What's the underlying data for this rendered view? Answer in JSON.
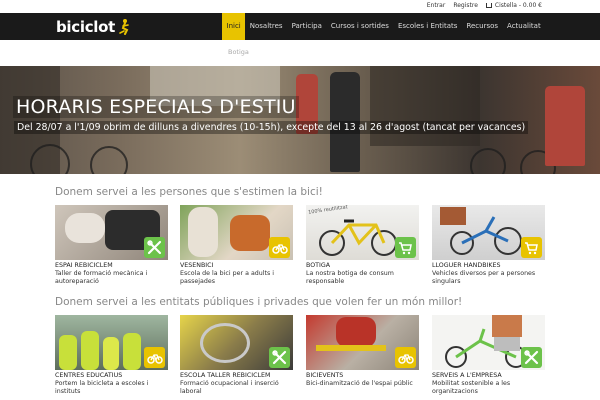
{
  "topbar": {
    "login": "Entrar",
    "register": "Registre",
    "cart": "Cistella - 0.00 €",
    "cart_icon": "cart-icon"
  },
  "logo": {
    "text": "biciclot",
    "icon": "bike-rider-logo-icon"
  },
  "nav": {
    "items": [
      "Inici",
      "Nosaltres",
      "Participa",
      "Cursos i sortides",
      "Escoles i Entitats",
      "Recursos",
      "Actualitat"
    ],
    "active_index": 0,
    "sub_item": "Botiga"
  },
  "hero": {
    "title": "HORARIS ESPECIALS D'ESTIU",
    "subtitle": "Del 28/07 a l'1/09 obrim de dilluns a divendres (10-15h), excepte del 13 al 26 d'agost (tancat per vacances)"
  },
  "section1": {
    "title": "Donem servei a les persones que s'estimen la bici!",
    "cards": [
      {
        "title": "ESPAI REBICICLEM",
        "desc": "Taller de formació mecànica i autoreparació",
        "badge": "green",
        "icon": "wrench-screwdriver-icon"
      },
      {
        "title": "VESenBICI",
        "desc": "Escola de la bici per a adults i passejades",
        "badge": "yellow",
        "icon": "bicycle-icon"
      },
      {
        "title": "BOTIGA",
        "desc": "La nostra botiga de consum responsable",
        "badge": "green",
        "icon": "shopping-cart-icon",
        "stamp": "100% reutilitzat"
      },
      {
        "title": "LLOGUER HANDBIKES",
        "desc": "Vehicles diversos per a persones singulars",
        "badge": "yellow",
        "icon": "cart-icon"
      }
    ]
  },
  "section2": {
    "title": "Donem servei a les entitats públiques i privades que volen fer un món millor!",
    "cards": [
      {
        "title": "CENTRES EDUCATIUS",
        "desc": "Portem la bicicleta a escoles i instituts",
        "badge": "yellow",
        "icon": "bicycle-icon"
      },
      {
        "title": "ESCOLA TALLER REBICICLEM",
        "desc": "Formació ocupacional i inserció laboral",
        "badge": "green",
        "icon": "wrench-screwdriver-icon"
      },
      {
        "title": "BICIEVENTS",
        "desc": "Bici-dinamització de l'espai públic",
        "badge": "yellow",
        "icon": "bicycle-icon"
      },
      {
        "title": "SERVEIS A L'EMPRESA",
        "desc": "Mobilitat sostenible a les organitzacions",
        "badge": "green",
        "icon": "wrench-screwdriver-icon"
      }
    ]
  },
  "colors": {
    "accent": "#e8c300",
    "green": "#6cc24a",
    "navbar": "#1a1a1a"
  }
}
